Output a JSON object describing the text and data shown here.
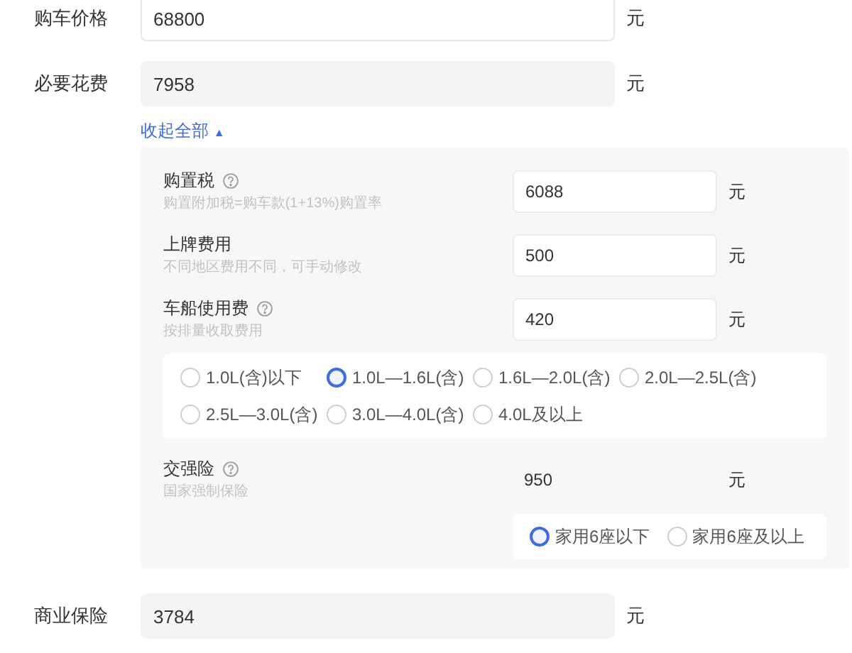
{
  "rows_top": [
    {
      "label": "购车价格",
      "value": "68800",
      "unit": "元",
      "readonly": false
    },
    {
      "label": "必要花费",
      "value": "7958",
      "unit": "元",
      "readonly": true
    }
  ],
  "collapse_link": {
    "label": "收起全部",
    "arrow": "▲"
  },
  "details": [
    {
      "label": "购置税",
      "help": true,
      "hint": "购置附加税=购车款(1+13%)购置率",
      "value": "6088",
      "unit": "元",
      "kind": "input"
    },
    {
      "label": "上牌费用",
      "help": false,
      "hint": "不同地区费用不同，可手动修改",
      "value": "500",
      "unit": "元",
      "kind": "input"
    },
    {
      "label": "车船使用费",
      "help": true,
      "hint": "按排量收取费用",
      "value": "420",
      "unit": "元",
      "kind": "input",
      "options": [
        {
          "label": "1.0L(含)以下",
          "selected": false
        },
        {
          "label": "1.0L—1.6L(含)",
          "selected": true
        },
        {
          "label": "1.6L—2.0L(含)",
          "selected": false
        },
        {
          "label": "2.0L—2.5L(含)",
          "selected": false
        },
        {
          "label": "2.5L—3.0L(含)",
          "selected": false
        },
        {
          "label": "3.0L—4.0L(含)",
          "selected": false
        },
        {
          "label": "4.0L及以上",
          "selected": false
        }
      ]
    },
    {
      "label": "交强险",
      "help": true,
      "hint": "国家强制保险",
      "value": "950",
      "unit": "元",
      "kind": "text",
      "seat_options": [
        {
          "label": "家用6座以下",
          "selected": true
        },
        {
          "label": "家用6座及以上",
          "selected": false
        }
      ]
    }
  ],
  "rows_bottom": [
    {
      "label": "商业保险",
      "value": "3784",
      "unit": "元",
      "readonly": true
    }
  ]
}
